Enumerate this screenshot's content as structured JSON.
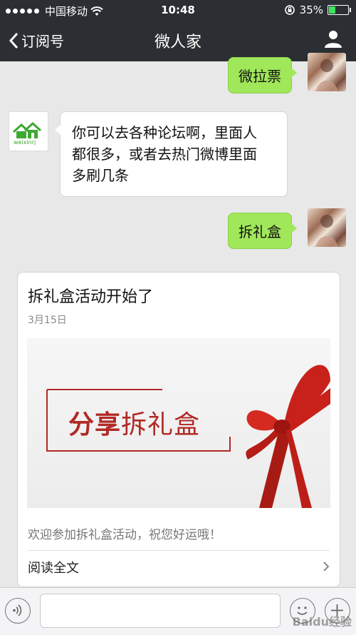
{
  "status_bar": {
    "carrier": "中国移动",
    "time": "10:48",
    "battery": "35%",
    "battery_level": 0.35
  },
  "nav": {
    "back_label": "订阅号",
    "title": "微人家"
  },
  "messages": [
    {
      "side": "right",
      "text": "微拉票"
    },
    {
      "side": "left",
      "lines": [
        "你可以去各种论坛啊，里面人",
        "都很多，或者去热门微博里面",
        "多刷几条"
      ]
    },
    {
      "side": "right",
      "text": "拆礼盒"
    }
  ],
  "brand_avatar": {
    "caption": "weixinrj"
  },
  "article_card": {
    "title": "拆礼盒活动开始了",
    "date": "3月15日",
    "image_text_bold": "分享",
    "image_text_rest": "拆礼盒",
    "description": "欢迎参加拆礼盒活动，祝您好运哦！",
    "read_more": "阅读全文"
  },
  "watermark": "Baidu经验",
  "colors": {
    "nav_bg": "#2b2f33",
    "bubble_green": "#a0e75a",
    "brand_green": "#3da832",
    "ribbon_red": "#c8211a",
    "accent_red": "#b02a26"
  }
}
